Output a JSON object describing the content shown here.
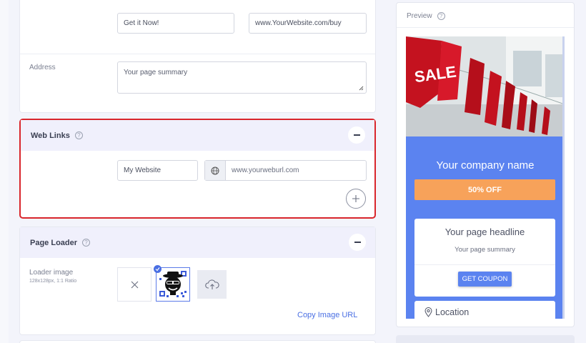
{
  "top_section": {
    "button_text_value": "Get it Now!",
    "button_url_value": "www.YourWebsite.com/buy",
    "address_label": "Address",
    "address_placeholder": "Your page summary"
  },
  "web_links": {
    "title": "Web Links",
    "help_icon": "question-circle-icon",
    "collapse_icon": "minus-icon",
    "link_name_value": "My Website",
    "link_url_placeholder": "www.yourweburl.com",
    "globe_icon": "globe-icon",
    "add_icon": "plus-circle-icon"
  },
  "page_loader": {
    "title": "Page Loader",
    "loader_label": "Loader image",
    "loader_hint": "128x128px, 1:1 Ratio",
    "remove_icon": "close-icon",
    "selected_image": "hacker-avatar-qr-image",
    "upload_icon": "cloud-upload-icon",
    "copy_link": "Copy Image URL"
  },
  "preview": {
    "label": "Preview",
    "hero_text": "SALE",
    "company_name": "Your company name",
    "offer": "50% OFF",
    "headline": "Your page headline",
    "summary": "Your page summary",
    "coupon_button": "GET COUPON",
    "location": "Location",
    "location_icon": "map-pin-icon"
  },
  "colors": {
    "accent": "#5b83f0",
    "offer": "#f7a25a",
    "highlight_border": "#d9262c",
    "link": "#4a6fe3"
  }
}
